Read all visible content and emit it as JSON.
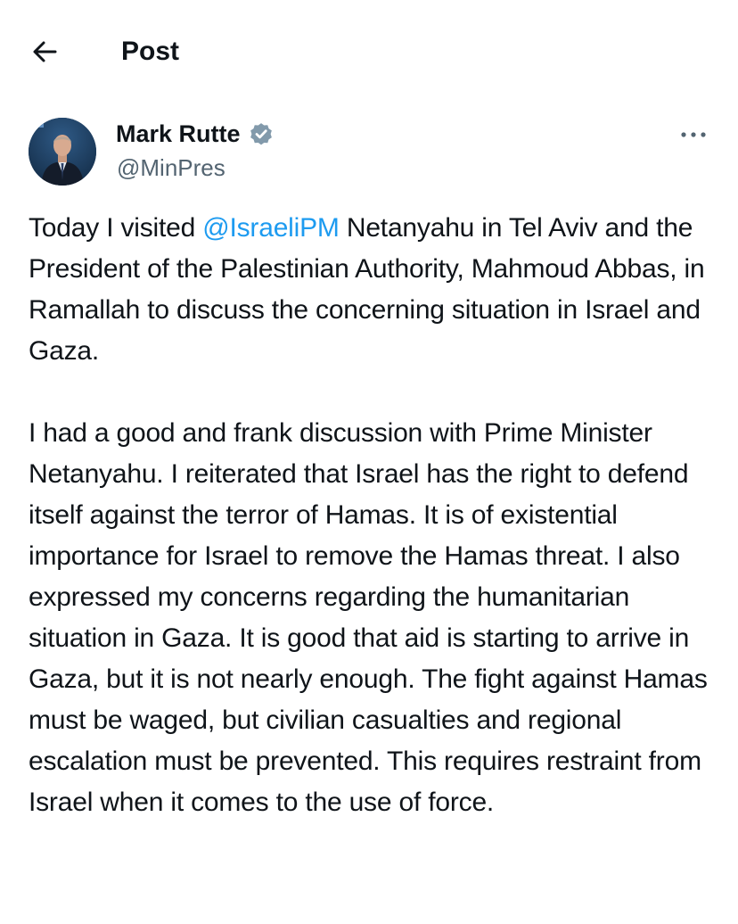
{
  "header": {
    "back_icon": "arrow-left-icon",
    "title": "Post"
  },
  "author": {
    "display_name": "Mark Rutte",
    "verified_icon": "verified-badge-icon",
    "verified_color": "#829aab",
    "handle": "@MinPres",
    "more_icon": "more-horizontal-icon"
  },
  "tweet": {
    "para1": {
      "before": "Today I visited ",
      "mention": "@IsraeliPM",
      "after": " Netanyahu in Tel Aviv and the President of the Palestinian Authority, Mahmoud Abbas, in Ramallah to discuss the concerning situation in Israel and Gaza."
    },
    "para2": "I had a good and frank discussion with Prime Minister Netanyahu. I reiterated that Israel has the right to defend itself against the terror of Hamas. It is of existential importance for Israel to remove the Hamas threat. I also expressed my concerns regarding the humanitarian situation in Gaza. It is good that aid is starting to arrive in Gaza, but it is not nearly enough. The fight against Hamas must be waged, but civilian casualties and regional escalation must be prevented. This requires restraint from Israel when it comes to the use of force."
  },
  "colors": {
    "text": "#0f1419",
    "secondary": "#536471",
    "link": "#1d9bf0"
  }
}
